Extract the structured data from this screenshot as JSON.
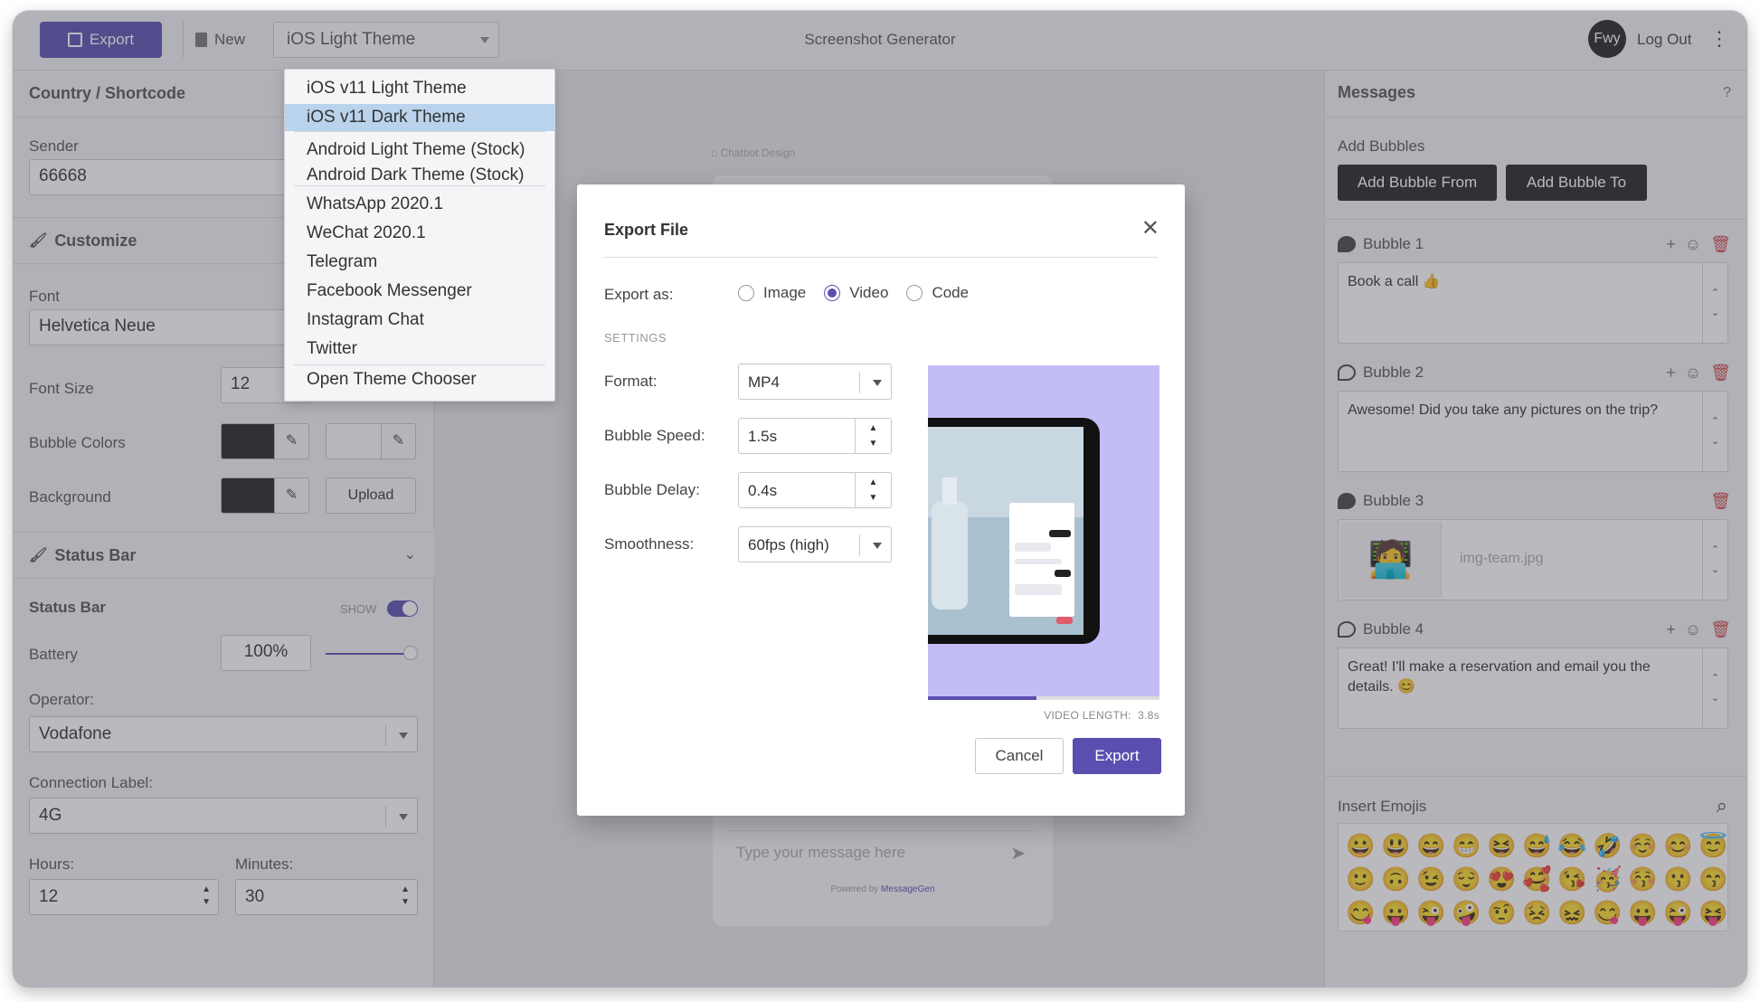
{
  "app": {
    "title": "Screenshot Generator",
    "export_label": "Export",
    "new_label": "New",
    "theme_selected": "iOS Light Theme",
    "avatar_initials": "Fwy",
    "logout_label": "Log Out",
    "accent_color": "#5a4fb0"
  },
  "theme_menu": {
    "items": [
      "iOS v11 Light Theme",
      "iOS v11 Dark Theme",
      "Android Light Theme (Stock)",
      "Android Dark Theme (Stock)",
      "WhatsApp 2020.1",
      "WeChat 2020.1",
      "Telegram",
      "Facebook Messenger",
      "Instagram Chat",
      "Twitter",
      "Open Theme Chooser"
    ],
    "highlighted": "iOS v11 Dark Theme"
  },
  "left": {
    "country_title": "Country / Shortcode",
    "sender_label": "Sender",
    "sender_value": "66668",
    "customize_title": "Customize",
    "font_label": "Font",
    "font_value": "Helvetica Neue",
    "font_size_label": "Font Size",
    "font_size_value": "12",
    "bubble_colors_label": "Bubble Colors",
    "background_label": "Background",
    "upload_label": "Upload",
    "status_section_title": "Status Bar",
    "status_bar_label": "Status Bar",
    "show_label": "SHOW",
    "battery_label": "Battery",
    "battery_value": "100%",
    "operator_label": "Operator:",
    "operator_value": "Vodafone",
    "connection_label": "Connection Label:",
    "connection_value": "4G",
    "hours_label": "Hours:",
    "hours_value": "12",
    "minutes_label": "Minutes:",
    "minutes_value": "30"
  },
  "center": {
    "chatbot_label": "Chatbot Design",
    "message_placeholder": "Type your message here",
    "powered_prefix": "Powered by",
    "powered_brand": "MessageGen"
  },
  "modal": {
    "title": "Export File",
    "export_as_label": "Export as:",
    "options": [
      "Image",
      "Video",
      "Code"
    ],
    "selected_option": "Video",
    "settings_label": "SETTINGS",
    "format_label": "Format:",
    "format_value": "MP4",
    "speed_label": "Bubble Speed:",
    "speed_value": "1.5s",
    "delay_label": "Bubble Delay:",
    "delay_value": "0.4s",
    "smooth_label": "Smoothness:",
    "smooth_value": "60fps (high)",
    "video_length_label": "VIDEO LENGTH:",
    "video_length_value": "3.8s",
    "progress": 0.47,
    "cancel_label": "Cancel",
    "export_label": "Export"
  },
  "right": {
    "messages_title": "Messages",
    "help": "?",
    "add_bubbles_label": "Add Bubbles",
    "add_from": "Add Bubble From",
    "add_to": "Add Bubble To",
    "bubbles": [
      {
        "name": "Bubble 1",
        "text": "Book a call 👍"
      },
      {
        "name": "Bubble 2",
        "text": "Awesome! Did you take any pictures on the trip?"
      },
      {
        "name": "Bubble 3",
        "text": "img-team.jpg"
      },
      {
        "name": "Bubble 4",
        "text": "Great! I'll make a reservation and email you the details. 😊"
      }
    ],
    "insert_emojis_label": "Insert Emojis",
    "emojis": [
      "😀",
      "😃",
      "😄",
      "😁",
      "😆",
      "😅",
      "😂",
      "🤣",
      "☺️",
      "😊",
      "😇",
      "🙂",
      "🙃",
      "😉",
      "😌",
      "😍",
      "🥰",
      "😘",
      "🥳",
      "😚",
      "😗",
      "😙",
      "😋",
      "😛",
      "😜",
      "🤪",
      "🤨",
      "😣",
      "😖",
      "😋",
      "😛",
      "😜",
      "😝"
    ]
  }
}
